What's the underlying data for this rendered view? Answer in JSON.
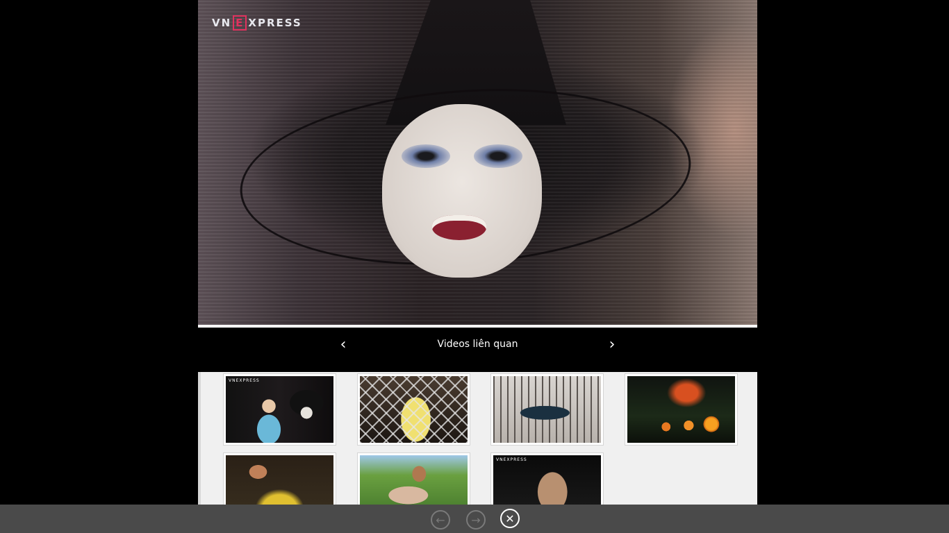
{
  "player": {
    "brand_prefix": "VN",
    "brand_mark": "E",
    "brand_suffix": "XPRESS",
    "progress": 1.0
  },
  "related": {
    "title": "Videos liên quan",
    "prev_arrow": "‹",
    "next_arrow": "›",
    "thumbnails": [
      {
        "id": "thumb-1",
        "logo": "VNEXPRESS"
      },
      {
        "id": "thumb-2",
        "logo": ""
      },
      {
        "id": "thumb-3",
        "logo": ""
      },
      {
        "id": "thumb-4",
        "logo": ""
      },
      {
        "id": "thumb-5",
        "logo": ""
      },
      {
        "id": "thumb-6",
        "logo": ""
      },
      {
        "id": "thumb-7",
        "logo": "VNEXPRESS"
      }
    ]
  },
  "appbar": {
    "back_icon": "arrow-left-icon",
    "back_glyph": "←",
    "forward_icon": "arrow-right-icon",
    "forward_glyph": "→",
    "close_icon": "close-icon",
    "close_glyph": "✕"
  },
  "colors": {
    "brand_accent": "#e0325e",
    "appbar": "#4a4a4a",
    "grid_background": "#f0f0f0"
  }
}
